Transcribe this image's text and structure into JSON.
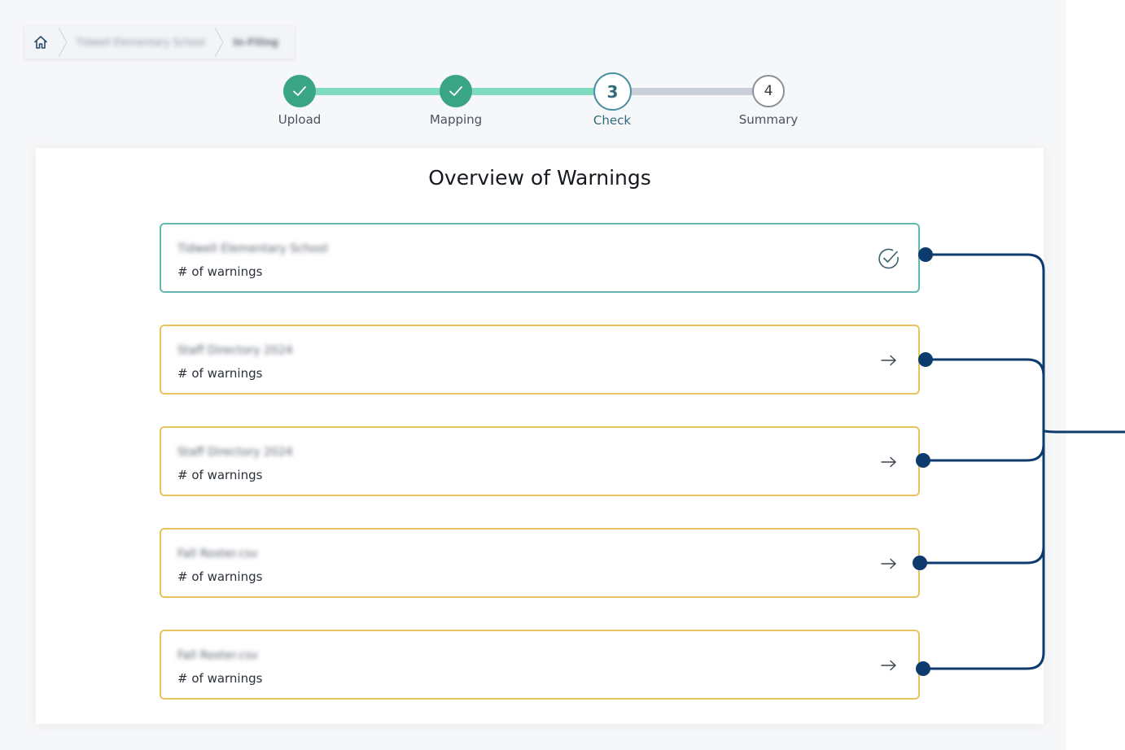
{
  "breadcrumb": {
    "home_icon": "home-icon",
    "items": [
      {
        "label": "Tidwell Elementary School"
      },
      {
        "label": "In-Filing"
      }
    ]
  },
  "stepper": {
    "steps": [
      {
        "label": "Upload",
        "state": "done",
        "icon": "check-icon"
      },
      {
        "label": "Mapping",
        "state": "done",
        "icon": "check-icon"
      },
      {
        "label": "Check",
        "number": "3",
        "state": "active"
      },
      {
        "label": "Summary",
        "number": "4",
        "state": "todo"
      }
    ]
  },
  "card": {
    "title": "Overview of Warnings",
    "items": [
      {
        "name": "Tidwell Elementary School",
        "count_label": "# of warnings",
        "status": "ok",
        "icon": "check-circle-icon"
      },
      {
        "name": "Staff Directory 2024",
        "count_label": "# of warnings",
        "status": "warning",
        "icon": "arrow-right-icon"
      },
      {
        "name": "Staff Directory 2024",
        "count_label": "# of warnings",
        "status": "warning",
        "icon": "arrow-right-icon"
      },
      {
        "name": "Fall Roster.csv",
        "count_label": "# of warnings",
        "status": "warning",
        "icon": "arrow-right-icon"
      },
      {
        "name": "Fall Roster.csv",
        "count_label": "# of warnings",
        "status": "warning",
        "icon": "arrow-right-icon"
      }
    ]
  },
  "colors": {
    "done_step": "#3aa584",
    "done_line": "#7fdcbf",
    "todo_line": "#c9cfd8",
    "active_step_border": "#4a8fa0",
    "ok_border": "#63b8b0",
    "warning_border": "#e8c25f",
    "annotation": "#0d3b6e"
  }
}
